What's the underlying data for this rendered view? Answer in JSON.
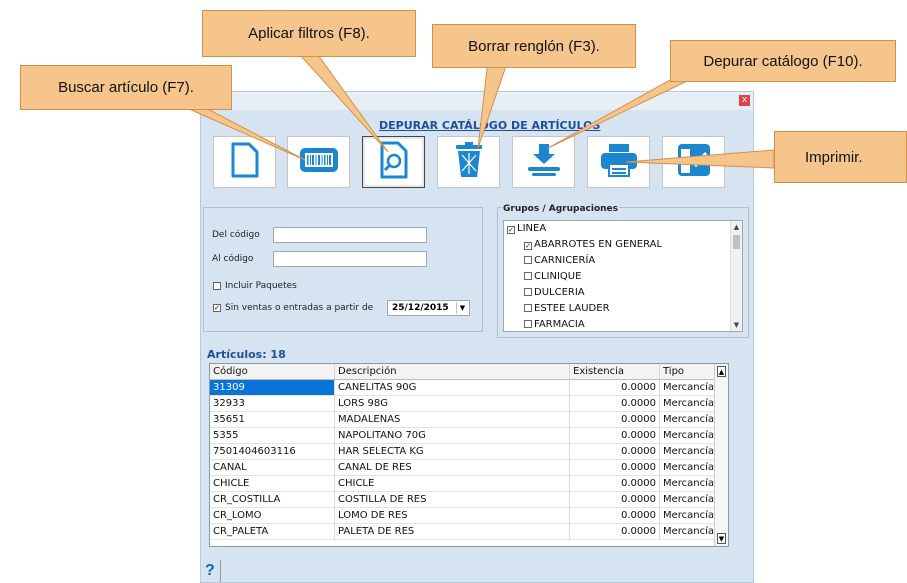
{
  "window": {
    "title": "DEPURAR CATÁLOGO DE ARTÍCULOS",
    "close_glyph": "x"
  },
  "toolbar": {
    "buttons": [
      {
        "name": "new-document",
        "icon": "document-icon"
      },
      {
        "name": "scan-barcode",
        "icon": "barcode-icon"
      },
      {
        "name": "apply-filters",
        "icon": "magnifier-document-icon"
      },
      {
        "name": "delete-row",
        "icon": "trash-icon"
      },
      {
        "name": "purge-catalog",
        "icon": "download-tray-icon"
      },
      {
        "name": "print",
        "icon": "printer-icon"
      },
      {
        "name": "exit",
        "icon": "checkbox-exit-icon"
      }
    ]
  },
  "filters": {
    "from_code_label": "Del código",
    "from_code_value": "",
    "to_code_label": "Al código",
    "to_code_value": "",
    "include_packages_label": "Incluir Paquetes",
    "include_packages_checked": false,
    "no_sales_label": "Sin ventas o entradas a partir de",
    "no_sales_checked": true,
    "date_value": "25/12/2015"
  },
  "groups": {
    "title": "Grupos / Agrupaciones",
    "root": {
      "label": "LINEA",
      "checked": true
    },
    "items": [
      {
        "label": "ABARROTES EN GENERAL",
        "checked": true
      },
      {
        "label": "CARNICERÍA",
        "checked": false
      },
      {
        "label": "CLINIQUE",
        "checked": false
      },
      {
        "label": "DULCERIA",
        "checked": false
      },
      {
        "label": "ESTEE LAUDER",
        "checked": false
      },
      {
        "label": "FARMACIA",
        "checked": false
      }
    ]
  },
  "articles": {
    "title": "Artículos: 18",
    "columns": [
      "Código",
      "Descripción",
      "Existencia",
      "Tipo"
    ],
    "rows": [
      [
        "31309",
        "CANELITAS 90G",
        "0.0000",
        "Mercancía"
      ],
      [
        "32933",
        "LORS 98G",
        "0.0000",
        "Mercancía"
      ],
      [
        "35651",
        "MADALENAS",
        "0.0000",
        "Mercancía"
      ],
      [
        "5355",
        "NAPOLITANO 70G",
        "0.0000",
        "Mercancía"
      ],
      [
        "7501404603116",
        "HAR SELECTA KG",
        "0.0000",
        "Mercancía"
      ],
      [
        "CANAL",
        "CANAL DE RES",
        "0.0000",
        "Mercancía"
      ],
      [
        "CHICLE",
        "CHICLE",
        "0.0000",
        "Mercancía"
      ],
      [
        "CR_COSTILLA",
        "COSTILLA DE RES",
        "0.0000",
        "Mercancía"
      ],
      [
        "CR_LOMO",
        "LOMO DE RES",
        "0.0000",
        "Mercancía"
      ],
      [
        "CR_PALETA",
        "PALETA DE RES",
        "0.0000",
        "Mercancía"
      ]
    ]
  },
  "callouts": {
    "search": "Buscar artículo (F7).",
    "filters": "Aplicar filtros (F8).",
    "delete": "Borrar renglón (F3).",
    "purge": "Depurar catálogo (F10).",
    "print": "Imprimir."
  },
  "help": {
    "glyph": "?"
  },
  "colors": {
    "accent": "#1f4f9a",
    "selection": "#0a74d6",
    "icon": "#1a87d0",
    "callout": "#f5c58c",
    "window_bg": "#d6e4f2"
  }
}
